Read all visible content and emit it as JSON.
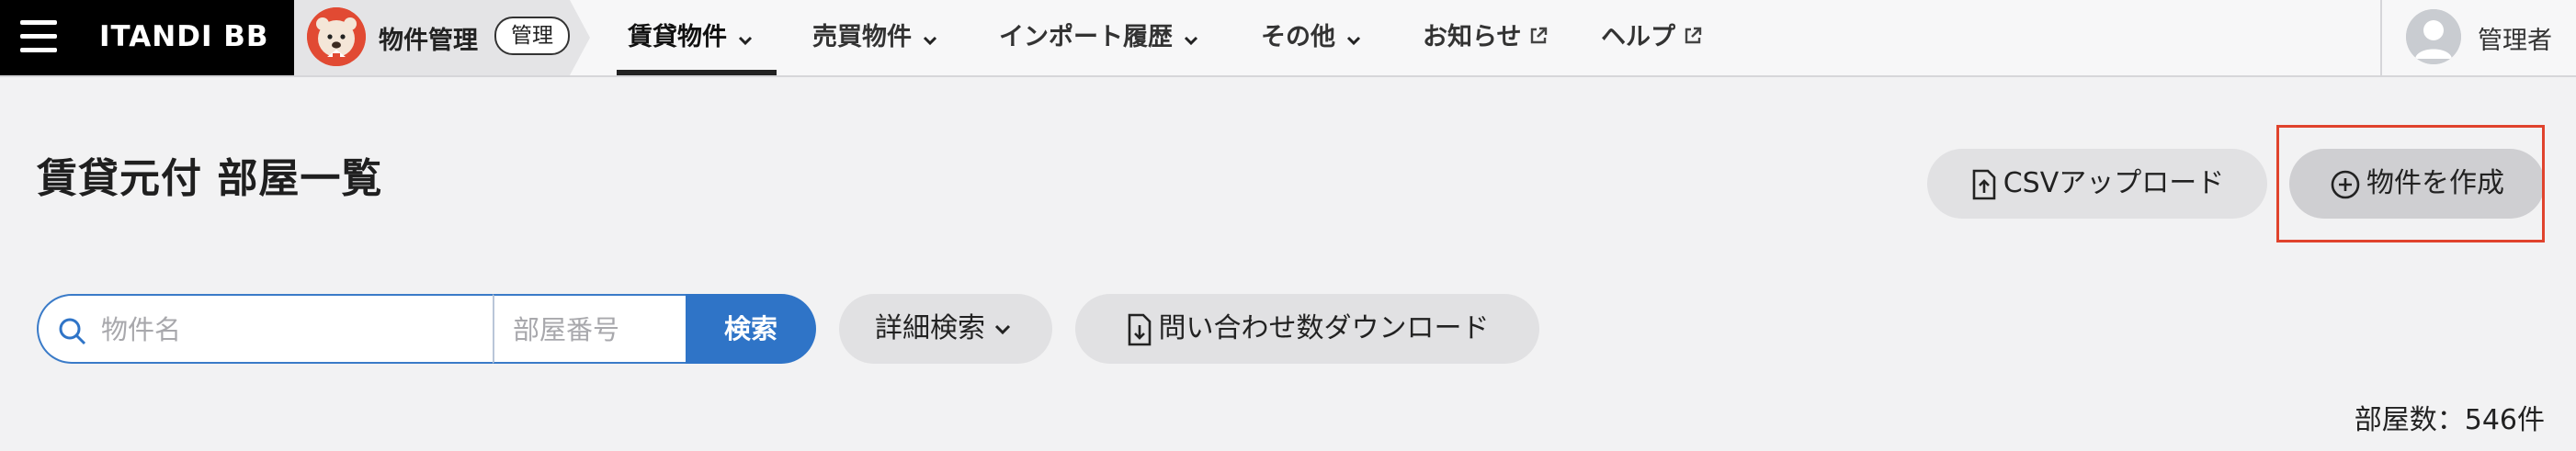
{
  "brand": {
    "name": "ITANDI BB"
  },
  "product": {
    "title": "物件管理",
    "badge": "管理"
  },
  "nav": {
    "items": [
      {
        "label": "賃貸物件",
        "dropdown": true,
        "external": false,
        "active": true
      },
      {
        "label": "売買物件",
        "dropdown": true,
        "external": false,
        "active": false
      },
      {
        "label": "インポート履歴",
        "dropdown": true,
        "external": false,
        "active": false
      },
      {
        "label": "その他",
        "dropdown": true,
        "external": false,
        "active": false
      },
      {
        "label": "お知らせ",
        "dropdown": false,
        "external": true,
        "active": false
      },
      {
        "label": "ヘルプ",
        "dropdown": false,
        "external": true,
        "active": false
      }
    ]
  },
  "user": {
    "name": "管理者"
  },
  "page": {
    "title": "賃貸元付 部屋一覧",
    "csv_upload_label": "CSVアップロード",
    "create_label": "物件を作成"
  },
  "search": {
    "property_placeholder": "物件名",
    "room_placeholder": "部屋番号",
    "search_label": "検索",
    "advanced_label": "詳細検索",
    "download_label": "問い合わせ数ダウンロード"
  },
  "result": {
    "count_label": "部屋数：546件"
  },
  "colors": {
    "brand_bg": "#000000",
    "accent": "#2f74c7",
    "highlight": "#e0432c",
    "avatar": "#e14a33"
  },
  "icons": [
    "menu-icon",
    "mascot-icon",
    "chevron-down-icon",
    "external-link-icon",
    "user-avatar-icon",
    "upload-icon",
    "plus-circle-icon",
    "search-icon",
    "download-icon"
  ]
}
